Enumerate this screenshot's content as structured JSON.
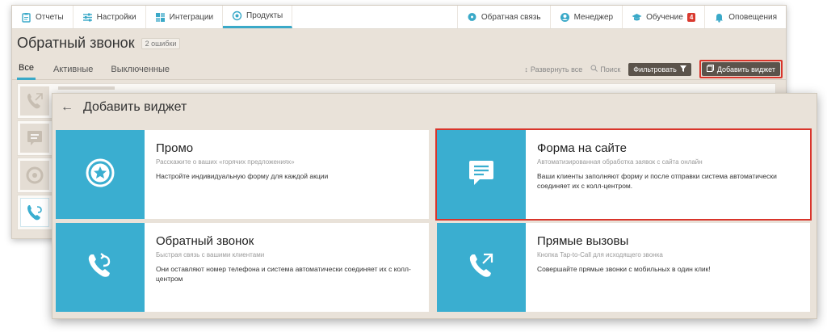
{
  "topnav": {
    "left": [
      {
        "label": "Отчеты",
        "icon": "clipboard-icon"
      },
      {
        "label": "Настройки",
        "icon": "sliders-icon"
      },
      {
        "label": "Интеграции",
        "icon": "puzzle-icon"
      },
      {
        "label": "Продукты",
        "icon": "products-icon",
        "active": true
      }
    ],
    "right": [
      {
        "label": "Обратная связь",
        "icon": "feedback-icon"
      },
      {
        "label": "Менеджер",
        "icon": "manager-icon"
      },
      {
        "label": "Обучение",
        "icon": "graduation-cap-icon",
        "badge": "4"
      },
      {
        "label": "Оповещения",
        "icon": "bell-icon"
      }
    ]
  },
  "page": {
    "title": "Обратный звонок",
    "errors_badge": "2 ошибки"
  },
  "tabs": {
    "all": "Все",
    "active": "Активные",
    "disabled": "Выключенные"
  },
  "tools": {
    "expand_all": "Развернуть все",
    "search": "Поиск",
    "filter": "Фильтровать",
    "add_widget": "Добавить виджет"
  },
  "modal": {
    "title": "Добавить виджет",
    "cards": [
      {
        "title": "Промо",
        "subtitle": "Расскажите о ваших «горячих предложениях»",
        "description": "Настройте индивидуальную форму для каждой акции"
      },
      {
        "title": "Форма на сайте",
        "subtitle": "Автоматизированная обработка заявок с сайта онлайн",
        "description": "Ваши клиенты заполняют форму и после отправки система автоматически соединяет их с колл-центром."
      },
      {
        "title": "Обратный звонок",
        "subtitle": "Быстрая связь с вашими клиентами",
        "description": "Они оставляют номер телефона и система автоматически соединяет их с колл-центром"
      },
      {
        "title": "Прямые вызовы",
        "subtitle": "Кнопка Tap-to-Call для исходящего звонка",
        "description": "Совершайте прямые звонки с мобильных в один клик!"
      }
    ]
  },
  "colors": {
    "accent": "#3aaed0",
    "highlight": "#d9352b",
    "panel": "#e9e2d9"
  }
}
